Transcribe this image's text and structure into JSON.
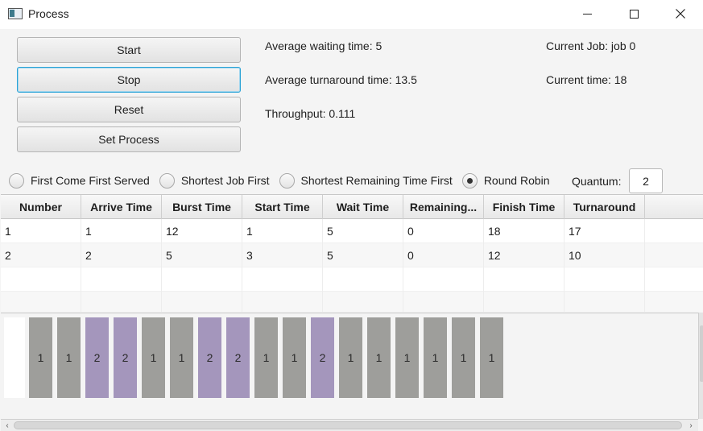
{
  "window": {
    "title": "Process",
    "close_glyph": "✕"
  },
  "buttons": [
    {
      "label": "Start"
    },
    {
      "label": "Stop"
    },
    {
      "label": "Reset"
    },
    {
      "label": "Set Process"
    }
  ],
  "stats": {
    "avg_waiting": "Average waiting time: 5",
    "avg_turnaround": "Average turnaround time: 13.5",
    "throughput": "Throughput: 0.111",
    "current_job": "Current Job: job 0",
    "current_time": "Current time: 18"
  },
  "algorithms": [
    {
      "label": "First Come First Served",
      "selected": false
    },
    {
      "label": "Shortest Job First",
      "selected": false
    },
    {
      "label": "Shortest Remaining Time First",
      "selected": false
    },
    {
      "label": "Round Robin",
      "selected": true
    }
  ],
  "quantum": {
    "label": "Quantum:",
    "value": "2"
  },
  "table": {
    "columns": [
      "Number",
      "Arrive Time",
      "Burst Time",
      "Start Time",
      "Wait Time",
      "Remaining...",
      "Finish Time",
      "Turnaround"
    ],
    "rows": [
      [
        "1",
        "1",
        "12",
        "1",
        "5",
        "0",
        "18",
        "17"
      ],
      [
        "2",
        "2",
        "5",
        "3",
        "5",
        "0",
        "12",
        "10"
      ]
    ]
  },
  "gantt": {
    "sequence": [
      "1",
      "1",
      "2",
      "2",
      "1",
      "1",
      "2",
      "2",
      "1",
      "1",
      "2",
      "1",
      "1",
      "1",
      "1",
      "1",
      "1"
    ],
    "colors": {
      "1": "#9e9e9b",
      "2": "#a496bc"
    }
  },
  "scroll": {
    "left_arrow": "‹",
    "right_arrow": "›"
  }
}
